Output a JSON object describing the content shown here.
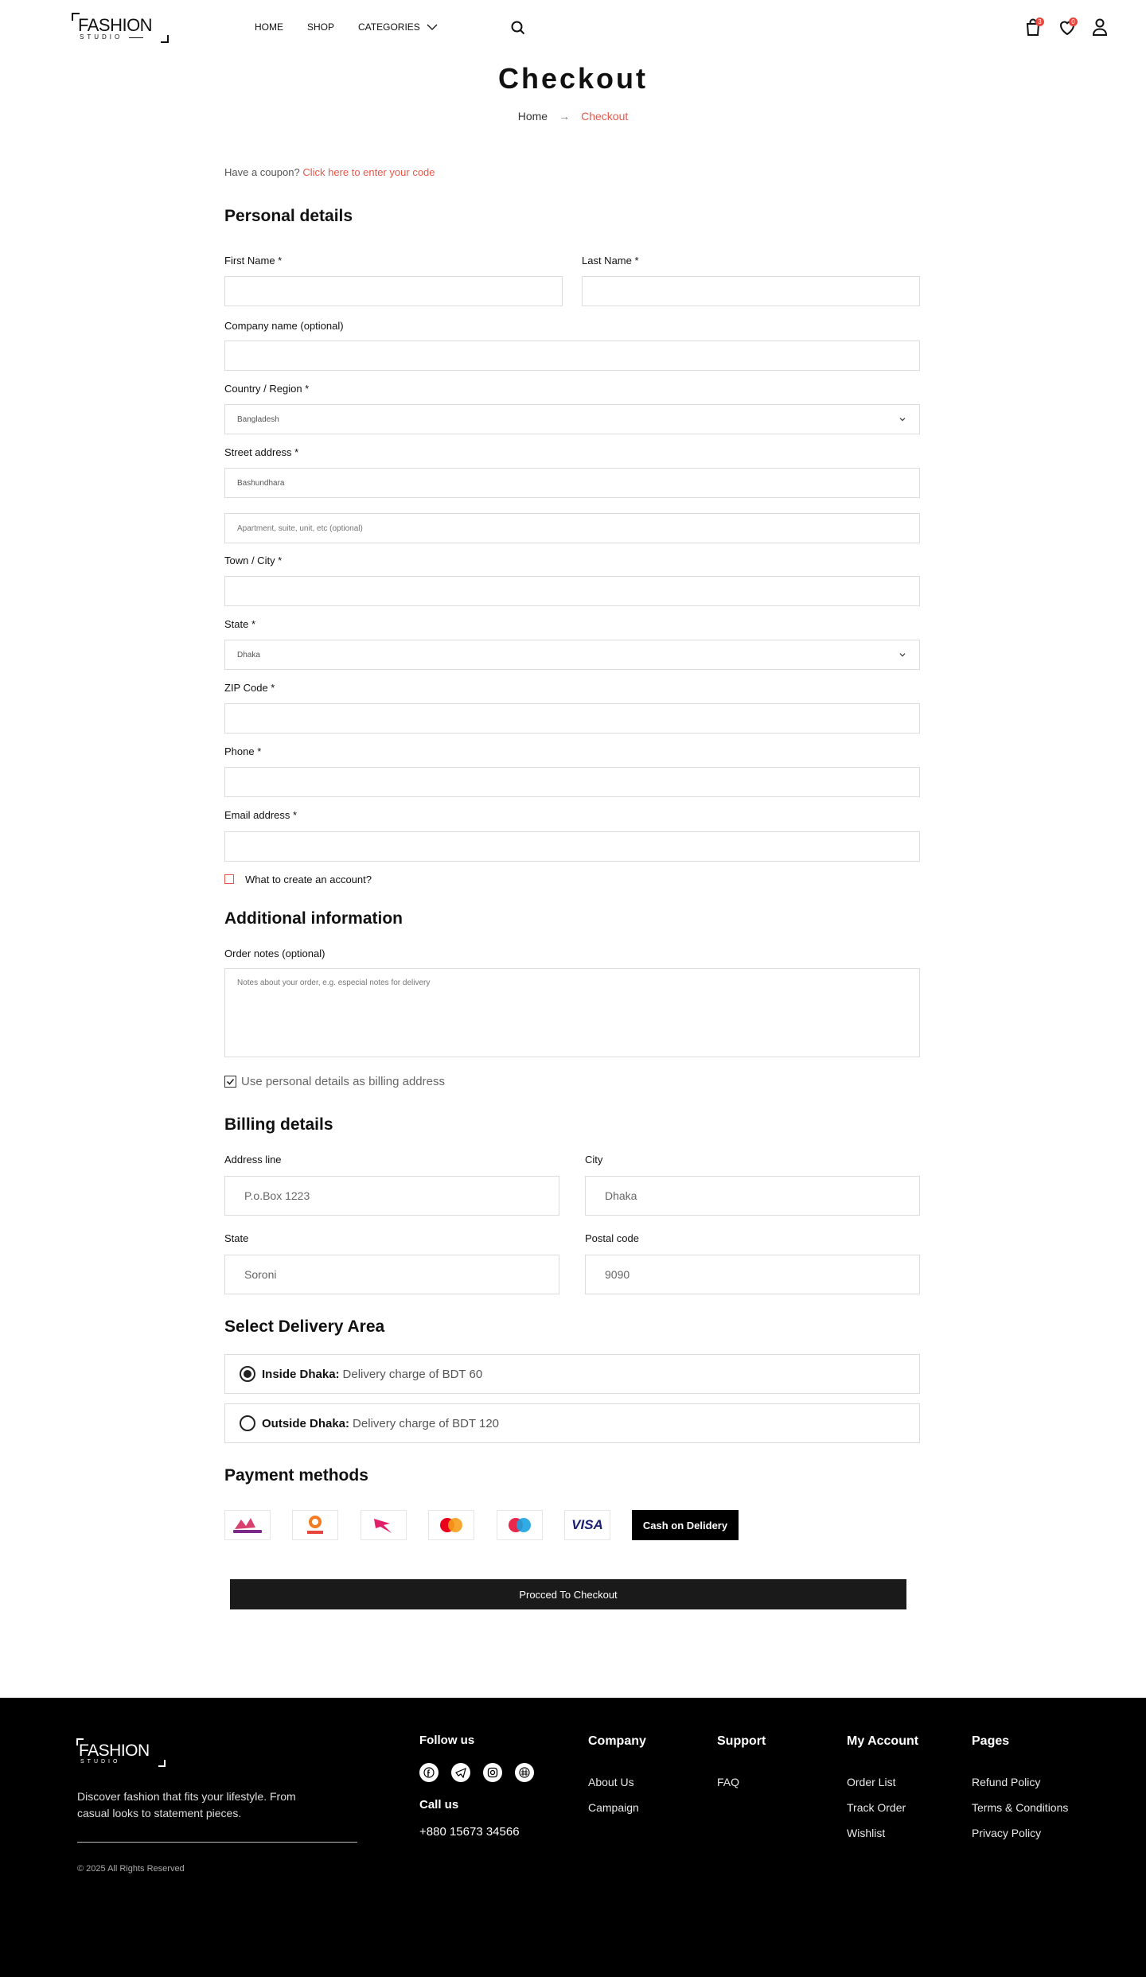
{
  "header": {
    "logo_main": "FASHION",
    "logo_sub": "STUDIO",
    "nav": [
      "HOME",
      "SHOP",
      "CATEGORIES"
    ],
    "cart_count": "3",
    "wishlist_count": "0"
  },
  "page": {
    "title": "Checkout",
    "breadcrumb_home": "Home",
    "breadcrumb_arrow": "→",
    "breadcrumb_current": "Checkout"
  },
  "coupon": {
    "prefix": "Have a coupon?",
    "link": "Click here to enter your code"
  },
  "personal": {
    "heading": "Personal details",
    "first_name_label": "First Name *",
    "last_name_label": "Last Name *",
    "company_label": "Company name (optional)",
    "country_label": "Country / Region *",
    "country_value": "Bangladesh",
    "street_label": "Street address *",
    "street_value": "Bashundhara",
    "apartment_placeholder": "Apartment, suite, unit, etc (optional)",
    "town_label": "Town / City *",
    "state_label": "State *",
    "state_value": "Dhaka",
    "zip_label": "ZIP Code *",
    "phone_label": "Phone *",
    "email_label": "Email address *",
    "create_account_label": "What to create an account?"
  },
  "additional": {
    "heading": "Additional information",
    "notes_label": "Order notes (optional)",
    "notes_placeholder": "Notes about your order, e.g. especial notes for delivery",
    "use_personal_label": "Use personal details as billing address"
  },
  "billing": {
    "heading": "Billing details",
    "address_label": "Address line",
    "address_value": "P.o.Box 1223",
    "city_label": "City",
    "city_value": "Dhaka",
    "state_label": "State",
    "state_value": "Soroni",
    "postal_label": "Postal code",
    "postal_value": "9090"
  },
  "delivery": {
    "heading": "Select Delivery Area",
    "options": [
      {
        "name": "Inside Dhaka:",
        "desc": "Delivery charge of BDT 60",
        "selected": true
      },
      {
        "name": "Outside Dhaka:",
        "desc": "Delivery charge of BDT 120",
        "selected": false
      }
    ]
  },
  "payment": {
    "heading": "Payment methods",
    "methods": [
      "bkash",
      "upay",
      "nagad",
      "mastercard",
      "maestro",
      "VISA"
    ],
    "cod_label": "Cash on Delidery",
    "proceed_label": "Procced To Checkout"
  },
  "footer": {
    "logo_main": "FASHION",
    "logo_sub": "STUDIO",
    "tagline": "Discover fashion that fits your lifestyle. From casual looks to statement pieces.",
    "copyright": "© 2025 All Rights Reserved",
    "follow_heading": "Follow us",
    "call_heading": "Call us",
    "phone": "+880 15673 34566",
    "company": {
      "heading": "Company",
      "links": [
        "About Us",
        "Campaign"
      ]
    },
    "support": {
      "heading": "Support",
      "links": [
        "FAQ"
      ]
    },
    "account": {
      "heading": "My Account",
      "links": [
        "Order List",
        "Track Order",
        "Wishlist"
      ]
    },
    "pages": {
      "heading": "Pages",
      "links": [
        "Refund Policy",
        "Terms & Conditions",
        "Privacy Policy"
      ]
    }
  },
  "colors": {
    "accent": "#e8584a",
    "dark": "#1a1a1a",
    "footer_bg": "#000000",
    "border": "#dcdcdc"
  }
}
